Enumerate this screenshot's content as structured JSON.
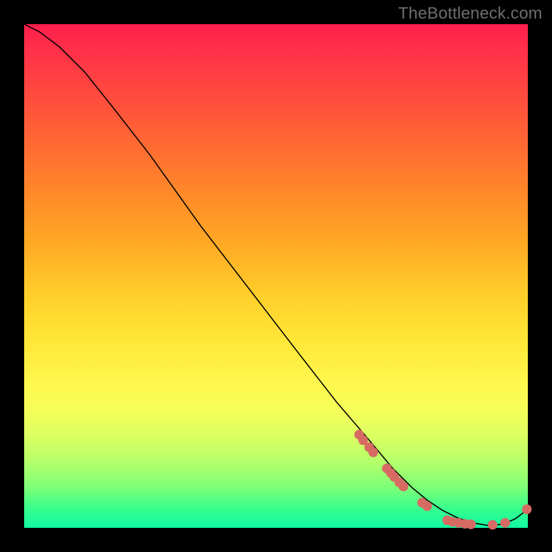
{
  "watermark": "TheBottleneck.com",
  "chart_data": {
    "type": "line",
    "title": "",
    "xlabel": "",
    "ylabel": "",
    "background": "rainbow-vertical",
    "curve": {
      "description": "bottleneck-curve decreasing roughly linearly from top-left to a minimum near x≈0.9 then rising slightly",
      "x": [
        0.0,
        0.03,
        0.07,
        0.12,
        0.18,
        0.25,
        0.35,
        0.45,
        0.55,
        0.62,
        0.68,
        0.73,
        0.77,
        0.8,
        0.83,
        0.86,
        0.89,
        0.92,
        0.95,
        0.975,
        1.0
      ],
      "y": [
        1.0,
        0.985,
        0.955,
        0.905,
        0.83,
        0.74,
        0.6,
        0.47,
        0.34,
        0.25,
        0.18,
        0.12,
        0.08,
        0.055,
        0.035,
        0.02,
        0.01,
        0.005,
        0.007,
        0.018,
        0.037
      ]
    },
    "markers": {
      "color": "#d76a63",
      "radius_px": 7,
      "points_xy": [
        [
          0.665,
          0.185
        ],
        [
          0.673,
          0.174
        ],
        [
          0.685,
          0.16
        ],
        [
          0.693,
          0.15
        ],
        [
          0.72,
          0.118
        ],
        [
          0.728,
          0.109
        ],
        [
          0.735,
          0.101
        ],
        [
          0.745,
          0.09
        ],
        [
          0.753,
          0.082
        ],
        [
          0.79,
          0.05
        ],
        [
          0.8,
          0.043
        ],
        [
          0.84,
          0.015
        ],
        [
          0.85,
          0.012
        ],
        [
          0.862,
          0.01
        ],
        [
          0.875,
          0.008
        ],
        [
          0.887,
          0.007
        ],
        [
          0.93,
          0.006
        ],
        [
          0.955,
          0.01
        ],
        [
          0.998,
          0.037
        ]
      ]
    },
    "xlim": [
      0,
      1
    ],
    "ylim": [
      0,
      1
    ]
  }
}
